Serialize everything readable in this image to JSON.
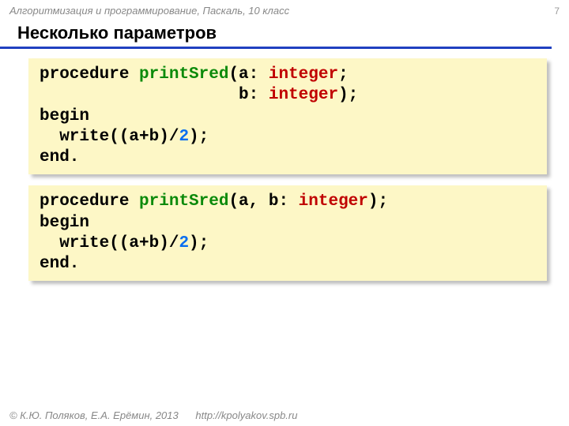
{
  "header": {
    "course": "Алгоритмизация и программирование, Паскаль, 10 класс",
    "page": "7"
  },
  "title": "Несколько параметров",
  "code1": {
    "l1_kw": "procedure ",
    "l1_name": "printSred",
    "l1_rest": "(a: ",
    "l1_type": "integer",
    "l1_semi": ";",
    "l2_pad": "                    b: ",
    "l2_type": "integer",
    "l2_close": ");",
    "l3": "begin",
    "l4_a": "  write((a+b)/",
    "l4_num": "2",
    "l4_b": ");",
    "l5": "end."
  },
  "code2": {
    "l1_kw": "procedure ",
    "l1_name": "printSred",
    "l1_rest": "(a, b: ",
    "l1_type": "integer",
    "l1_close": ");",
    "l2": "begin",
    "l3_a": "  write((a+b)/",
    "l3_num": "2",
    "l3_b": ");",
    "l4": "end."
  },
  "footer": {
    "copy": "© К.Ю. Поляков, Е.А. Ерёмин, 2013",
    "url": "http://kpolyakov.spb.ru"
  }
}
